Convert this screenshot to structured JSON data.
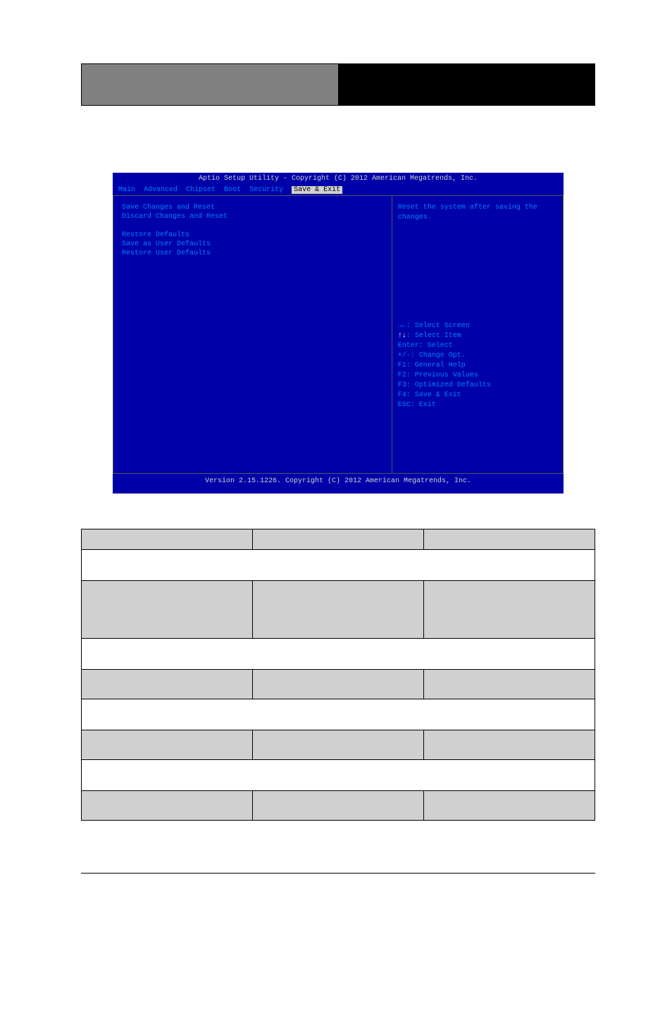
{
  "header": {
    "left_text": "",
    "right_text": ""
  },
  "bios": {
    "title": "Aptio Setup Utility - Copyright (C) 2012 American Megatrends, Inc.",
    "menu": [
      "Main",
      "Advanced",
      "Chipset",
      "Boot",
      "Security",
      "Save & Exit"
    ],
    "menu_selected_index": 5,
    "left_items": [
      "Save Changes and Reset",
      "Discard Changes and Reset",
      "",
      "Restore Defaults",
      "Save as User Defaults",
      "Restore User Defaults"
    ],
    "help_text": "Reset the system after saving the changes.",
    "keys": {
      "screen": "→←: Select Screen",
      "item": "↑↓: Select Item",
      "enter": "Enter: Select",
      "change": "+/-: Change Opt.",
      "f1": "F1: General Help",
      "f2": "F2: Previous Values",
      "f3": "F3: Optimized Defaults",
      "f4": "F4: Save & Exit",
      "esc": "ESC: Exit"
    },
    "footer": "Version 2.15.1226. Copyright (C) 2012 American Megatrends, Inc."
  },
  "table": {
    "headers": [
      "",
      "",
      ""
    ],
    "rows": [
      {
        "type": "span",
        "text": ""
      },
      {
        "type": "gray-tall",
        "cells": [
          "",
          "",
          ""
        ]
      },
      {
        "type": "span",
        "text": ""
      },
      {
        "type": "gray",
        "cells": [
          "",
          "",
          ""
        ]
      },
      {
        "type": "span",
        "text": ""
      },
      {
        "type": "gray",
        "cells": [
          "",
          "",
          ""
        ]
      },
      {
        "type": "span",
        "text": ""
      },
      {
        "type": "gray",
        "cells": [
          "",
          "",
          ""
        ]
      }
    ]
  }
}
